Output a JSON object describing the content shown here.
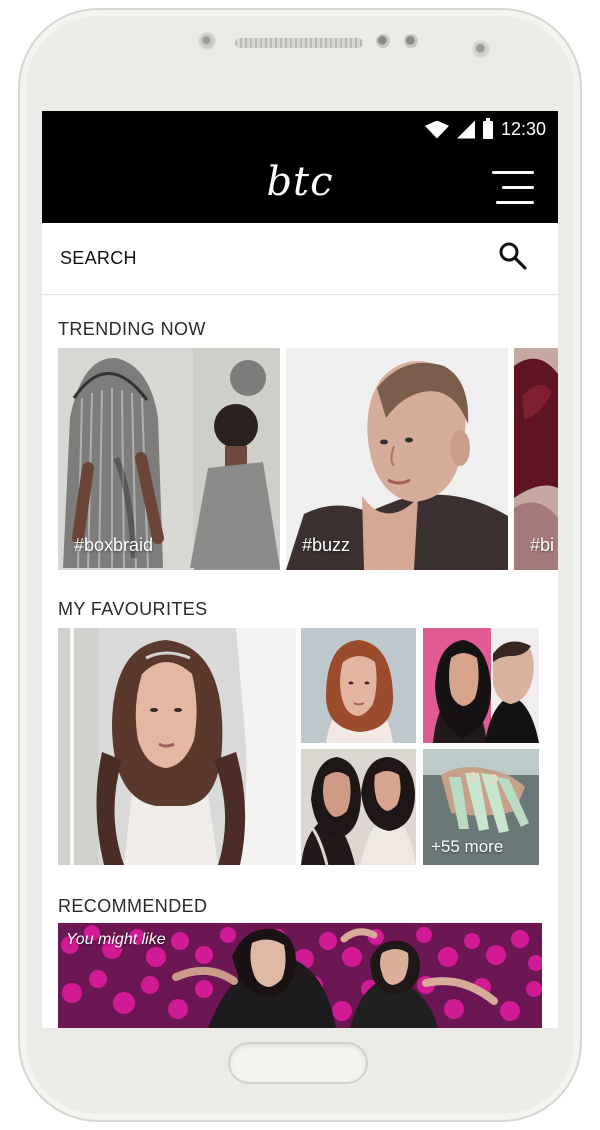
{
  "status_bar": {
    "time": "12:30",
    "icons": [
      "wifi-icon",
      "signal-icon",
      "battery-icon"
    ]
  },
  "app": {
    "logo": "btc",
    "menu_icon": "menu-icon"
  },
  "search": {
    "label": "SEARCH",
    "icon": "search-icon"
  },
  "trending": {
    "heading": "TRENDING NOW",
    "items": [
      {
        "tag": "#boxbraid",
        "image": "two people with braided hairstyles"
      },
      {
        "tag": "#buzz",
        "image": "person with buzz cut"
      },
      {
        "tag": "#bi",
        "image": "dark rose bouquet"
      }
    ]
  },
  "favourites": {
    "heading": "MY FAVOURITES",
    "items": [
      "woman with long wavy brown hair",
      "woman with long red hair",
      "two people with dark hair",
      "two women with dark hair",
      "manicured long nails"
    ],
    "more_label": "+55 more"
  },
  "recommended": {
    "heading": "RECOMMENDED",
    "banner_label": "You might like",
    "image": "people in pink ball pit"
  },
  "colors": {
    "top_bar": "#000000",
    "background": "#ffffff",
    "phone_shell": "#ebebe7",
    "accent_pink": "#d61c98"
  }
}
